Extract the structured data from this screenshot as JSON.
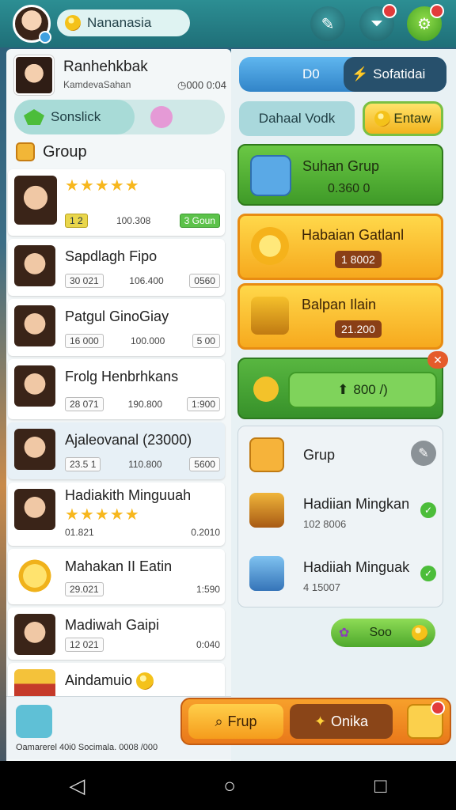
{
  "header": {
    "username": "Nananasia"
  },
  "profile": {
    "name": "Ranhehkbak",
    "subtitle": "KamdevaSahan",
    "stat": "◷000 0:04"
  },
  "tabs": {
    "active_label": "Sonslick"
  },
  "group": {
    "heading": "Group"
  },
  "list": [
    {
      "title": "",
      "stars": "★★★★★",
      "badge": "1 2",
      "value": "100.308",
      "tag": "3 Goun"
    },
    {
      "title": "Sapdlagh Fipo",
      "left": "30 021",
      "value": "106.400",
      "tag": "0560"
    },
    {
      "title": "Patgul GinoGiay",
      "left": "16 000",
      "value": "100.000",
      "tag": "5 00"
    },
    {
      "title": "Frolg Henbrhkans",
      "left": "28 071",
      "value": "190.800",
      "tag": "1:900"
    },
    {
      "title": "Ajaleovanal (23000)",
      "left": "23.5 1",
      "value": "110.800",
      "tag": "5600"
    },
    {
      "title": "Hadiakith Minguuah",
      "stars": "★★★★★",
      "left": "01.821",
      "value": "",
      "tag": "0.2010"
    },
    {
      "title": "Mahakan II Eatin",
      "left": "29.021",
      "value": "",
      "tag": "1:590"
    },
    {
      "title": "Madiwah Gaipi",
      "left": "12 021",
      "value": "",
      "tag": "0:040"
    },
    {
      "title": "Aindamuio",
      "left": "",
      "value": "",
      "tag": ""
    }
  ],
  "right": {
    "top_left_text": "D0",
    "top_right_text": "Sofatidai",
    "teal_button": "Dahaal Vodk",
    "yellow_button": "Entaw",
    "green_card": {
      "title": "Suhan Grup",
      "value": "0.360 0"
    },
    "orange_card_1": {
      "title": "Habaian Gatlanl",
      "price": "1 8002"
    },
    "orange_card_2": {
      "title": "Balpan Ilain",
      "price": "21.200"
    },
    "action_button": "800 /)",
    "white_card": {
      "header": "Grup",
      "row1": {
        "title": "Hadiian Mingkan",
        "value": "102 8006"
      },
      "row2": {
        "title": "Hadiiah Minguak",
        "value": "4 15007"
      }
    },
    "pill_button": "Soo"
  },
  "bottom": {
    "footer_text": "Oamarerel 40i0 Socimala.  0008 /000",
    "btn1": "Frup",
    "btn2": "Onika"
  },
  "colors": {
    "header": "#2c8e93",
    "green": "#4ea82c",
    "orange": "#f6a91e"
  }
}
